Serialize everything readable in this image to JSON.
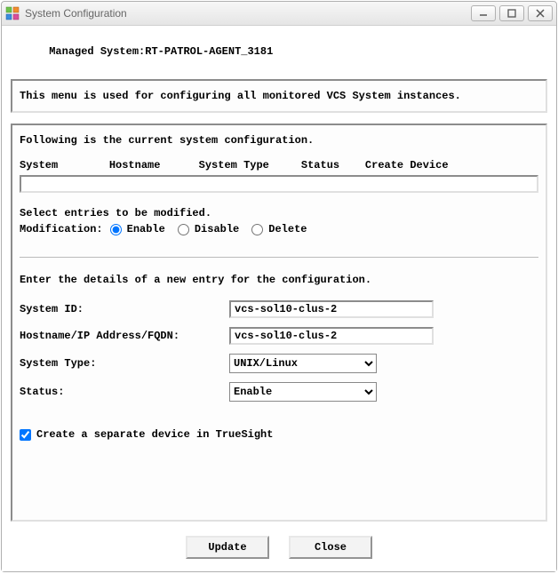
{
  "window": {
    "title": "System Configuration"
  },
  "header": {
    "prefix": "Managed System:",
    "system_name": "RT-PATROL-AGENT_3181"
  },
  "info_box": "This menu is used for configuring all monitored VCS System instances.",
  "panel": {
    "intro": "Following is the current system configuration.",
    "columns": {
      "c1": "System",
      "c2": "Hostname",
      "c3": "System Type",
      "c4": "Status",
      "c5": "Create Device"
    },
    "select_line": "Select entries to be modified.",
    "mod_label": "Modification:",
    "mod_options": {
      "enable": "Enable",
      "disable": "Disable",
      "delete": "Delete"
    },
    "mod_selected": "enable",
    "detail_intro": "Enter the details of a new entry for the configuration.",
    "fields": {
      "system_id_label": "System ID:",
      "system_id_value": "vcs-sol10-clus-2",
      "hostname_label": "Hostname/IP Address/FQDN:",
      "hostname_value": "vcs-sol10-clus-2",
      "system_type_label": "System Type:",
      "system_type_value": "UNIX/Linux",
      "status_label": "Status:",
      "status_value": "Enable"
    },
    "checkbox_label": "Create a separate device in TrueSight",
    "checkbox_checked": true
  },
  "buttons": {
    "update": "Update",
    "close": "Close"
  }
}
